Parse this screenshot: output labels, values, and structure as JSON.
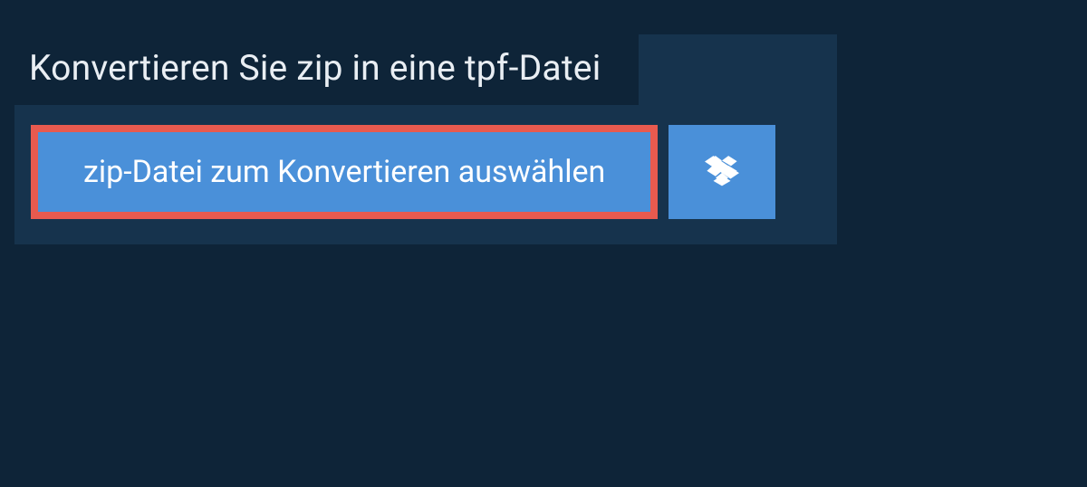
{
  "header": {
    "title": "Konvertieren Sie zip in eine tpf-Datei"
  },
  "actions": {
    "select_file_label": "zip-Datei zum Konvertieren auswählen",
    "dropbox_icon": "dropbox-icon"
  },
  "colors": {
    "bg_outer": "#0e2438",
    "bg_panel": "#16334d",
    "button_bg": "#4a90d9",
    "highlight_border": "#e85a4f",
    "text_light": "#ffffff"
  }
}
